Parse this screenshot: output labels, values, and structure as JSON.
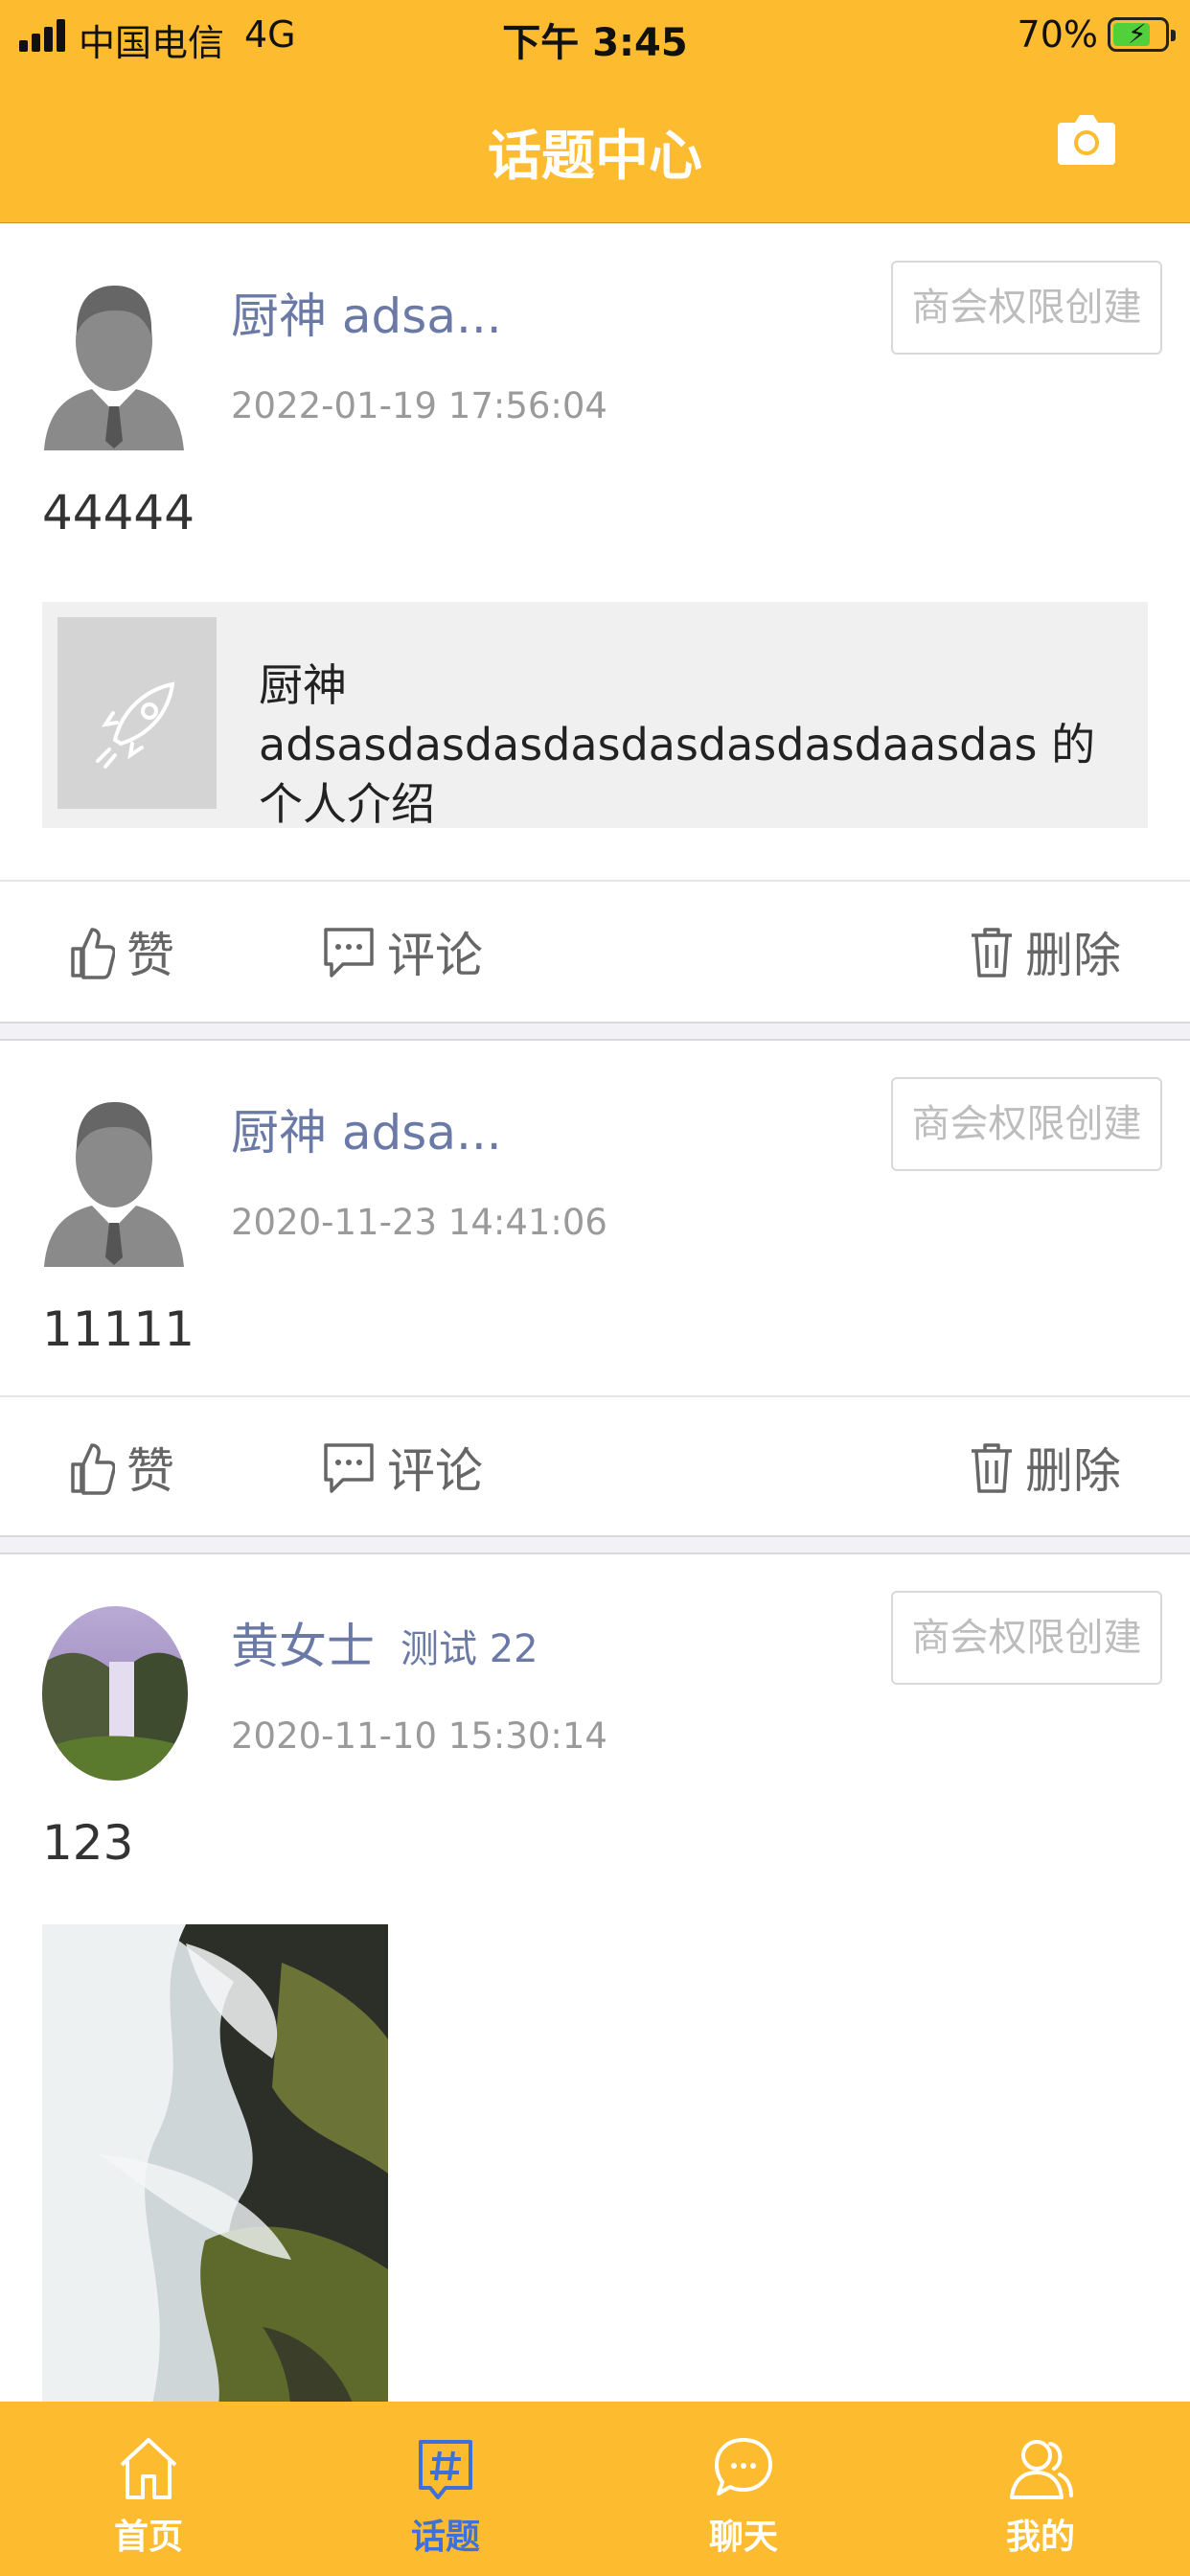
{
  "status_bar": {
    "carrier": "中国电信",
    "network": "4G",
    "time": "下午 3:45",
    "battery": "70%"
  },
  "header": {
    "title": "话题中心"
  },
  "posts": [
    {
      "name": "厨神 adsa...",
      "time": "2022-01-19 17:56:04",
      "button": "商会权限创建",
      "content": "44444",
      "share_text": "厨神 adsasdasdasdasdasdasdasdaasdas 的个人介绍",
      "like": "赞",
      "comment": "评论",
      "delete": "删除"
    },
    {
      "name": "厨神 adsa...",
      "time": "2020-11-23 14:41:06",
      "button": "商会权限创建",
      "content": "11111",
      "like": "赞",
      "comment": "评论",
      "delete": "删除"
    },
    {
      "name": "黄女士",
      "tagline": "测试 22",
      "time": "2020-11-10 15:30:14",
      "button": "商会权限创建",
      "content": "123"
    }
  ],
  "tabbar": [
    {
      "label": "首页",
      "icon": "home-icon"
    },
    {
      "label": "话题",
      "icon": "hashtag-icon",
      "active": true
    },
    {
      "label": "聊天",
      "icon": "chat-bubble-icon"
    },
    {
      "label": "我的",
      "icon": "user-icon"
    }
  ],
  "colors": {
    "header": "#fdbb2f",
    "name": "#6a79a6",
    "tab_active": "#3f6fd8"
  }
}
